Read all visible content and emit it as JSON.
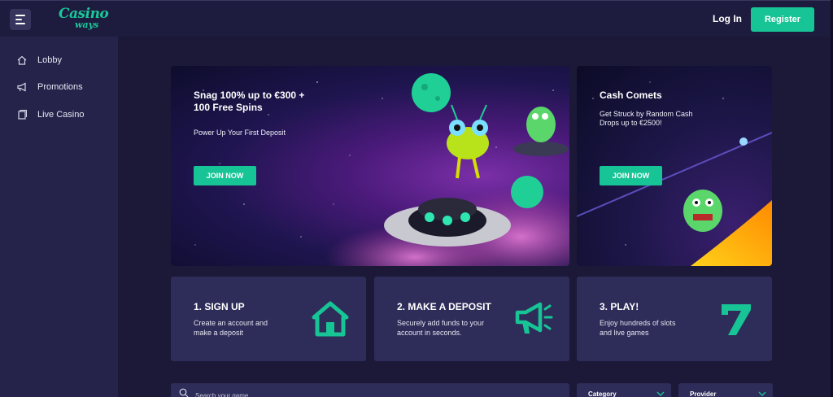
{
  "header": {
    "logo_main": "Casino",
    "logo_sub": "ways",
    "login_label": "Log In",
    "register_label": "Register"
  },
  "sidebar": {
    "items": [
      {
        "label": "Lobby",
        "icon": "home-icon"
      },
      {
        "label": "Promotions",
        "icon": "megaphone-icon"
      },
      {
        "label": "Live Casino",
        "icon": "cards-icon"
      }
    ]
  },
  "banners": [
    {
      "title_line1": "Snag 100% up to €300 +",
      "title_line2": "100 Free Spins",
      "subtitle": "Power Up Your First Deposit",
      "button": "JOIN NOW"
    },
    {
      "title": "Cash Comets",
      "subtitle_line1": "Get Struck by Random Cash",
      "subtitle_line2": "Drops up to €2500!",
      "button": "JOIN NOW"
    }
  ],
  "steps": [
    {
      "title": "1. SIGN UP",
      "desc_line1": "Create an account and",
      "desc_line2": "make a deposit",
      "icon": "house-icon"
    },
    {
      "title": "2. MAKE A DEPOSIT",
      "desc_line1": "Securely add funds to your",
      "desc_line2": "account in seconds.",
      "icon": "megaphone-icon"
    },
    {
      "title": "3. PLAY!",
      "desc_line1": "Enjoy hundreds of slots",
      "desc_line2": "and live games",
      "icon": "seven-icon"
    }
  ],
  "filters": {
    "search_placeholder": "Search your game...",
    "category_label": "Category",
    "provider_label": "Provider"
  },
  "colors": {
    "accent": "#17c495",
    "background": "#1b1937",
    "sidebar": "#25234a",
    "card": "#2e2c58"
  }
}
